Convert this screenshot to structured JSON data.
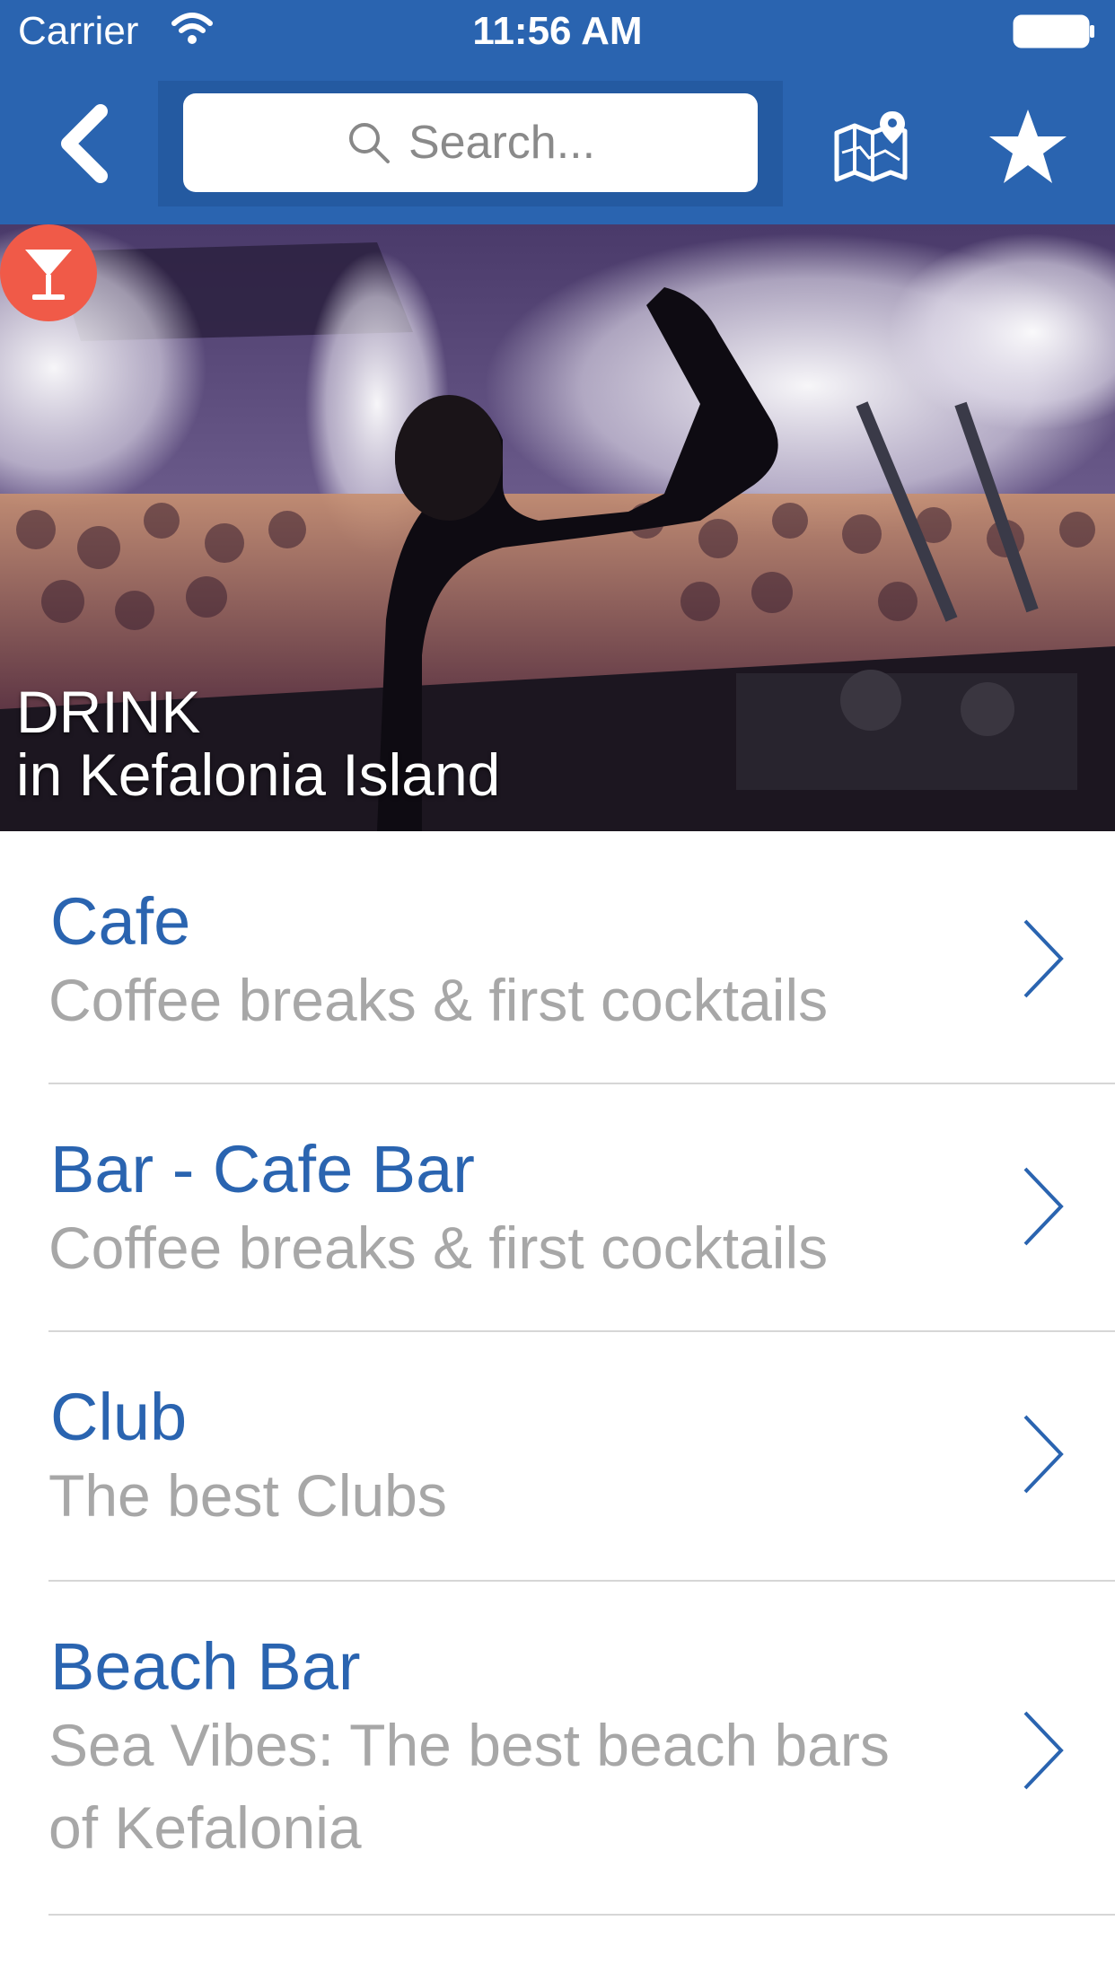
{
  "status_bar": {
    "carrier": "Carrier",
    "time": "11:56 AM"
  },
  "nav": {
    "search_placeholder": "Search..."
  },
  "hero": {
    "title": "DRINK",
    "subtitle": "in Kefalonia Island"
  },
  "categories": [
    {
      "title": "Cafe",
      "subtitle": "Coffee breaks & first cocktails"
    },
    {
      "title": "Bar - Cafe Bar",
      "subtitle": "Coffee breaks & first cocktails"
    },
    {
      "title": "Club",
      "subtitle": "The best Clubs"
    },
    {
      "title": "Beach Bar",
      "subtitle": "Sea Vibes: The best beach bars of Kefalonia"
    }
  ],
  "icons": {
    "back": "back-chevron-icon",
    "search": "search-icon",
    "map": "map-pin-icon",
    "favorite": "star-icon",
    "hero_badge": "cocktail-icon",
    "row": "chevron-right-icon"
  },
  "colors": {
    "header": "#2a64b0",
    "accent": "#2a64b0",
    "badge": "#f05a48",
    "subtitle": "#a7a7a7"
  }
}
